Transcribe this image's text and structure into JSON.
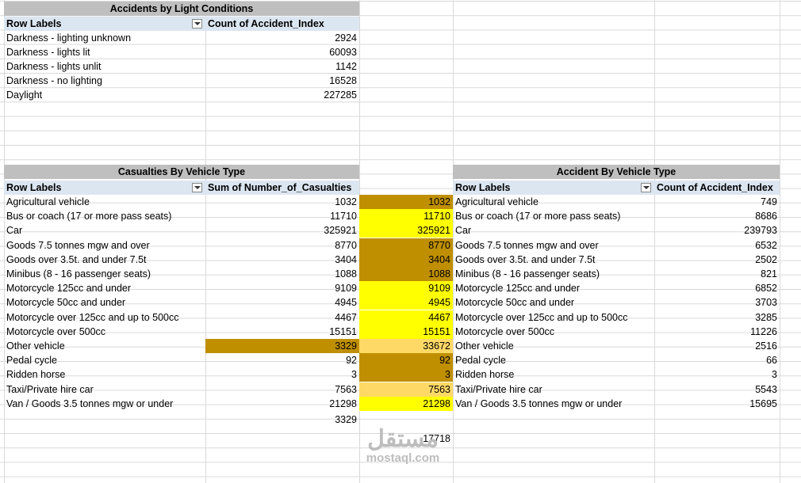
{
  "light": {
    "title": "Accidents by Light Conditions",
    "header_labels": "Row Labels",
    "header_values": "Count of Accident_Index",
    "rows": [
      {
        "label": "Darkness - lighting unknown",
        "value": "2924"
      },
      {
        "label": "Darkness - lights lit",
        "value": "60093"
      },
      {
        "label": "Darkness - lights unlit",
        "value": "1142"
      },
      {
        "label": "Darkness - no lighting",
        "value": "16528"
      },
      {
        "label": "Daylight",
        "value": "227285"
      }
    ]
  },
  "casualties": {
    "title": "Casualties By Vehicle Type",
    "header_labels": "Row Labels",
    "header_values": "Sum of Number_of_Casualties",
    "rows": [
      {
        "label": "Agricultural vehicle",
        "value": "1032",
        "col_d": "1032",
        "col_d_fill": "gold"
      },
      {
        "label": "Bus or coach (17 or more pass seats)",
        "value": "11710",
        "col_d": "11710",
        "col_d_fill": "yellow"
      },
      {
        "label": "Car",
        "value": "325921",
        "col_d": "325921",
        "col_d_fill": "yellow"
      },
      {
        "label": "Goods 7.5 tonnes mgw and over",
        "value": "8770",
        "col_d": "8770",
        "col_d_fill": "gold"
      },
      {
        "label": "Goods over 3.5t. and under 7.5t",
        "value": "3404",
        "col_d": "3404",
        "col_d_fill": "gold"
      },
      {
        "label": "Minibus (8 - 16 passenger seats)",
        "value": "1088",
        "col_d": "1088",
        "col_d_fill": "gold"
      },
      {
        "label": "Motorcycle 125cc and under",
        "value": "9109",
        "col_d": "9109",
        "col_d_fill": "yellow"
      },
      {
        "label": "Motorcycle 50cc and under",
        "value": "4945",
        "col_d": "4945",
        "col_d_fill": "yellow"
      },
      {
        "label": "Motorcycle over 125cc and up to 500cc",
        "value": "4467",
        "col_d": "4467",
        "col_d_fill": "yellow"
      },
      {
        "label": "Motorcycle over 500cc",
        "value": "15151",
        "col_d": "15151",
        "col_d_fill": "yellow"
      },
      {
        "label": "Other vehicle",
        "value": "3329",
        "col_d": "33672",
        "col_d_fill": "light-orange",
        "value_fill": "gold"
      },
      {
        "label": "Pedal cycle",
        "value": "92",
        "col_d": "92",
        "col_d_fill": "gold"
      },
      {
        "label": "Ridden horse",
        "value": "3",
        "col_d": "3",
        "col_d_fill": "gold"
      },
      {
        "label": "Taxi/Private hire car",
        "value": "7563",
        "col_d": "7563",
        "col_d_fill": "light-orange"
      },
      {
        "label": "Van / Goods 3.5 tonnes mgw or under",
        "value": "21298",
        "col_d": "21298",
        "col_d_fill": "yellow"
      }
    ],
    "extra_c": "3329",
    "extra_d": "17718"
  },
  "accidents": {
    "title": "Accident By Vehicle Type",
    "header_labels": "Row Labels",
    "header_values": "Count of Accident_Index",
    "rows": [
      {
        "label": "Agricultural vehicle",
        "value": "749"
      },
      {
        "label": "Bus or coach (17 or more pass seats)",
        "value": "8686"
      },
      {
        "label": "Car",
        "value": "239793"
      },
      {
        "label": "Goods 7.5 tonnes mgw and over",
        "value": "6532"
      },
      {
        "label": "Goods over 3.5t. and under 7.5t",
        "value": "2502"
      },
      {
        "label": "Minibus (8 - 16 passenger seats)",
        "value": "821"
      },
      {
        "label": "Motorcycle 125cc and under",
        "value": "6852"
      },
      {
        "label": "Motorcycle 50cc and under",
        "value": "3703"
      },
      {
        "label": "Motorcycle over 125cc and up to 500cc",
        "value": "3285"
      },
      {
        "label": "Motorcycle over 500cc",
        "value": "11226"
      },
      {
        "label": "Other vehicle",
        "value": "2516"
      },
      {
        "label": "Pedal cycle",
        "value": "66"
      },
      {
        "label": "Ridden horse",
        "value": "3"
      },
      {
        "label": "Taxi/Private hire car",
        "value": "5543"
      },
      {
        "label": "Van / Goods 3.5 tonnes mgw or under",
        "value": "15695"
      }
    ]
  },
  "watermark": {
    "arabic": "مستقل",
    "latin": "mostaql.com"
  },
  "colors": {
    "gold": "#bf8f00",
    "yellow": "#ffff00",
    "light-orange": "#ffd966",
    "title_fill": "#bfbfbf",
    "header_fill": "#dce6f1",
    "gridline": "#d9d9d9"
  }
}
